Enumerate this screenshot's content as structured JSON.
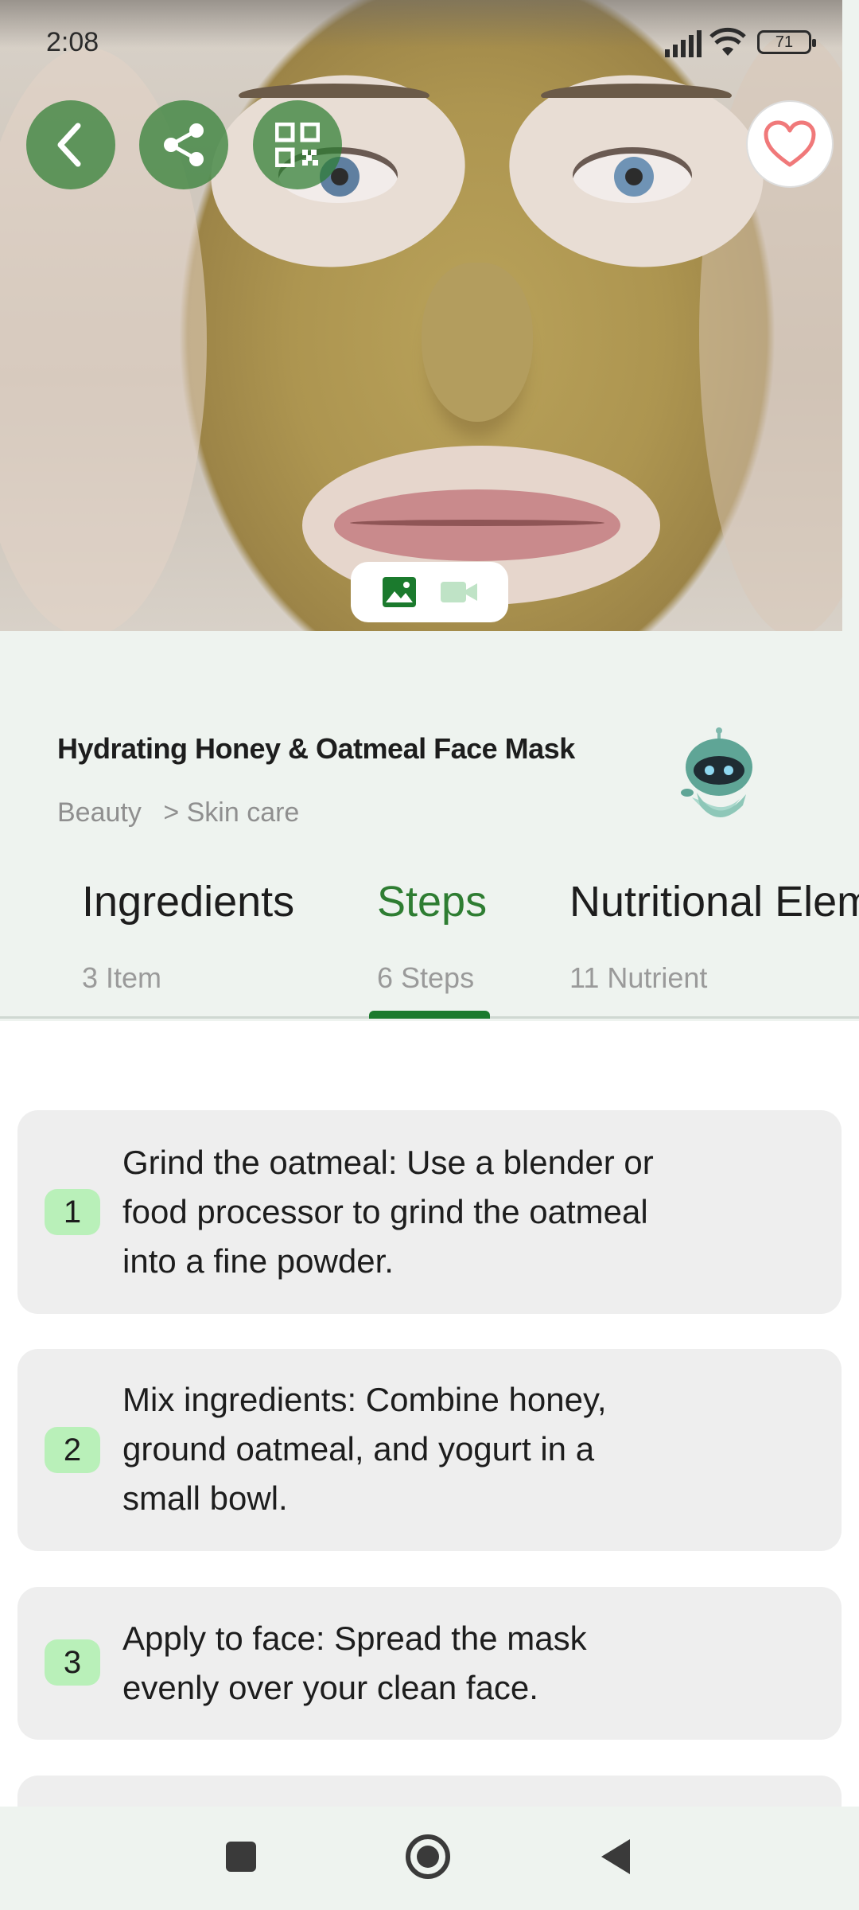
{
  "status_bar": {
    "time": "2:08",
    "battery": "71"
  },
  "hero": {
    "media_tabs": [
      "image",
      "video"
    ]
  },
  "header": {
    "title": "Hydrating Honey & Oatmeal Face Mask",
    "breadcrumb": {
      "category": "Beauty",
      "subcategory": "> Skin care"
    }
  },
  "tabs": [
    {
      "label": "Ingredients",
      "sub": "3 Item",
      "active": false
    },
    {
      "label": "Steps",
      "sub": "6 Steps",
      "active": true
    },
    {
      "label": "Nutritional Elem",
      "sub": "11 Nutrient",
      "active": false
    }
  ],
  "steps": [
    {
      "number": "1",
      "text": "Grind the oatmeal: Use a blender or food processor to grind the oatmeal into a fine powder."
    },
    {
      "number": "2",
      "text": "Mix ingredients: Combine honey, ground oatmeal, and yogurt in a small bowl."
    },
    {
      "number": "3",
      "text": "Apply to face: Spread the mask evenly over your clean face."
    }
  ],
  "colors": {
    "accent": "#2e7d32",
    "badge": "#b9f0b9",
    "card": "#eeeeee",
    "background": "#eef3ef"
  },
  "icons": [
    "back-icon",
    "share-icon",
    "qr-code-icon",
    "heart-icon",
    "image-icon",
    "video-icon",
    "robot-assistant-icon",
    "nav-recents-icon",
    "nav-home-icon",
    "nav-back-icon"
  ]
}
